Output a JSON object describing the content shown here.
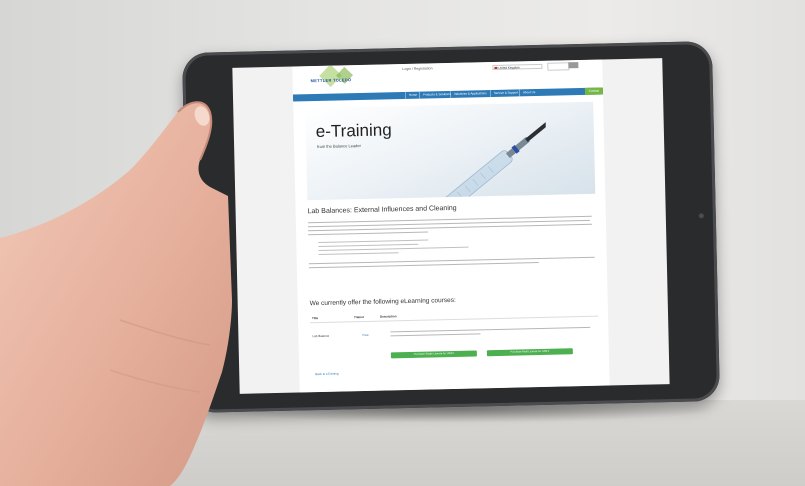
{
  "site": {
    "logo_text": "METTLER TOLEDO",
    "login_link": "Login / Registration",
    "country_selector": "United Kingdom",
    "nav_items": [
      "Home",
      "Products & Solutions",
      "Industries & Applications",
      "Service & Support",
      "About Us"
    ],
    "nav_cta": "Contact"
  },
  "hero": {
    "title": "e-Training",
    "subtitle": "from the Balance Leader"
  },
  "article": {
    "heading": "Lab Balances: External Influences and Cleaning",
    "offer_heading": "We currently offer the following eLearning courses:"
  },
  "course_table": {
    "headers": [
      "Title",
      "Trainer",
      "Description"
    ],
    "rows": [
      {
        "title": "Lab Balance",
        "trainer": "Free"
      }
    ],
    "buttons": [
      "Purchase Single License for US$ 0",
      "Purchase Multi-License for US$ 0"
    ],
    "back_link": "Back to eTraining"
  },
  "colors": {
    "nav_blue": "#2d7ab6",
    "cta_green": "#4caf50",
    "tablet_frame": "#2a2b2d"
  }
}
